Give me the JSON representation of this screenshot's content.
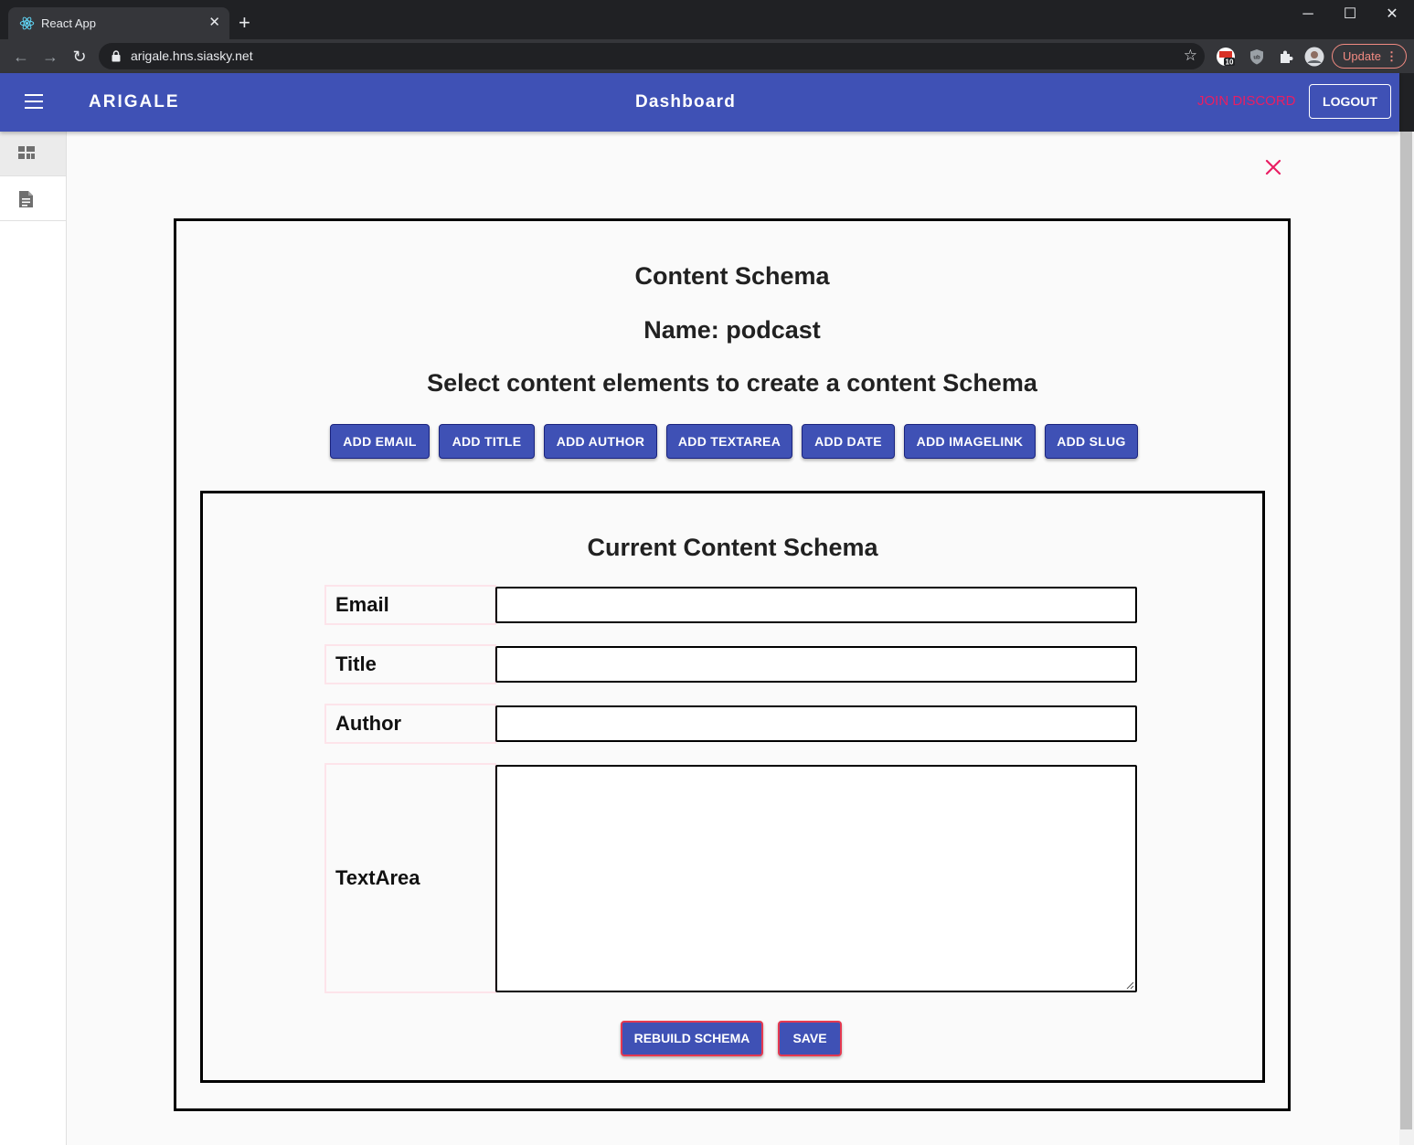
{
  "browser": {
    "tab_title": "React App",
    "url": "arigale.hns.siasky.net",
    "update_label": "Update",
    "extension_badge": "10"
  },
  "appbar": {
    "brand": "ARIGALE",
    "title": "Dashboard",
    "discord_label": "JOIN DISCORD",
    "logout_label": "LOGOUT"
  },
  "sidebar": {
    "items": [
      {
        "icon": "dashboard-icon",
        "active": true
      },
      {
        "icon": "document-icon",
        "active": false
      }
    ]
  },
  "schema": {
    "heading": "Content Schema",
    "name_line": "Name: podcast",
    "instruction": "Select content elements to create a content Schema",
    "add_buttons": [
      "ADD EMAIL",
      "ADD TITLE",
      "ADD AUTHOR",
      "ADD TEXTAREA",
      "ADD DATE",
      "ADD IMAGELINK",
      "ADD SLUG"
    ],
    "current_heading": "Current Content Schema",
    "fields": [
      {
        "label": "Email",
        "type": "input",
        "value": ""
      },
      {
        "label": "Title",
        "type": "input",
        "value": ""
      },
      {
        "label": "Author",
        "type": "input",
        "value": ""
      },
      {
        "label": "TextArea",
        "type": "textarea",
        "value": ""
      }
    ],
    "rebuild_label": "REBUILD SCHEMA",
    "save_label": "SAVE"
  },
  "colors": {
    "primary": "#3f51b5",
    "accent": "#e91e63",
    "action_border": "#e53950"
  }
}
